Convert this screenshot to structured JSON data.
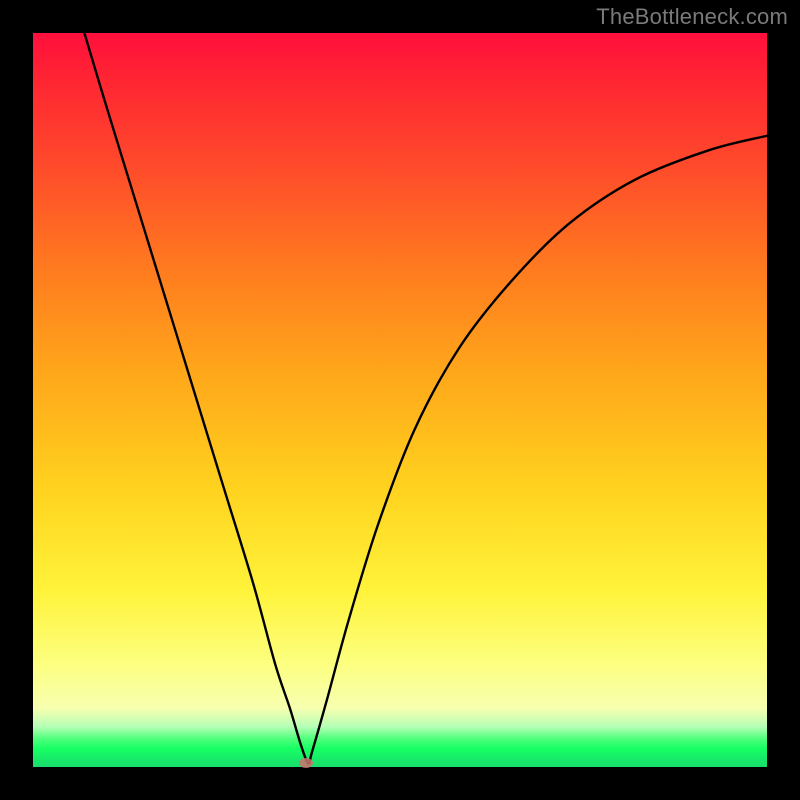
{
  "watermark": "TheBottleneck.com",
  "chart_data": {
    "type": "line",
    "title": "",
    "xlabel": "",
    "ylabel": "",
    "xlim": [
      0,
      100
    ],
    "ylim": [
      0,
      100
    ],
    "grid": false,
    "legend": false,
    "background_gradient": {
      "stops": [
        {
          "pos": 0,
          "color": "#ff0f3d"
        },
        {
          "pos": 46,
          "color": "#ffa61a"
        },
        {
          "pos": 76,
          "color": "#fff33a"
        },
        {
          "pos": 96,
          "color": "#18ff64"
        },
        {
          "pos": 100,
          "color": "#17df6a"
        }
      ],
      "direction": "top-to-bottom",
      "note": "V-shaped bottleneck curve over red-to-green gradient"
    },
    "series": [
      {
        "name": "bottleneck-curve",
        "color": "#000000",
        "x": [
          7,
          10,
          14,
          18,
          22,
          26,
          30,
          33,
          35,
          36.5,
          37.5,
          38,
          40,
          43,
          47,
          52,
          58,
          65,
          73,
          82,
          92,
          100
        ],
        "y": [
          100,
          90,
          77,
          64,
          51,
          38,
          25,
          14,
          8,
          3,
          0.5,
          2,
          9,
          20,
          33,
          46,
          57,
          66,
          74,
          80,
          84,
          86
        ]
      }
    ],
    "marker": {
      "x": 37.2,
      "y": 0.5,
      "color": "#cf716f"
    }
  }
}
